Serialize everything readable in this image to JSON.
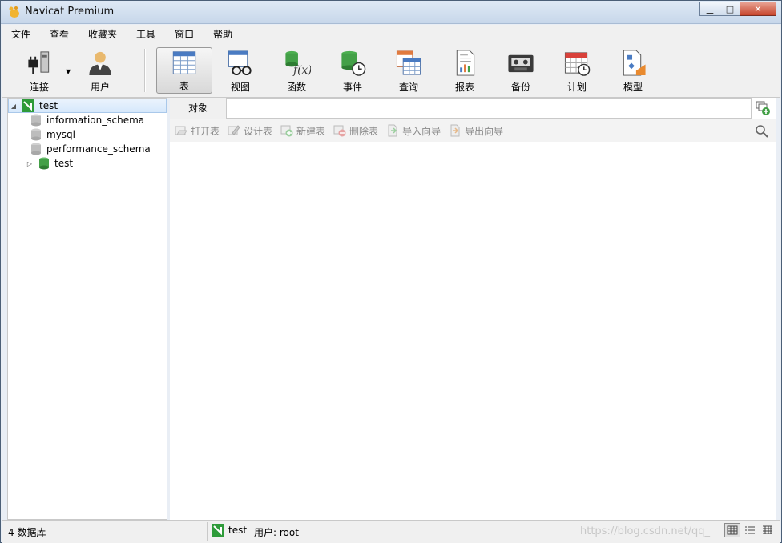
{
  "window": {
    "title": "Navicat Premium"
  },
  "menu": [
    "文件",
    "查看",
    "收藏夹",
    "工具",
    "窗口",
    "帮助"
  ],
  "toolbar": {
    "connect": "连接",
    "user": "用户",
    "items": [
      "表",
      "视图",
      "函数",
      "事件",
      "查询",
      "报表",
      "备份",
      "计划",
      "模型"
    ]
  },
  "tree": {
    "connection": "test",
    "databases": [
      "information_schema",
      "mysql",
      "performance_schema",
      "test"
    ]
  },
  "objects": {
    "tab_label": "对象",
    "actions": [
      "打开表",
      "设计表",
      "新建表",
      "删除表",
      "导入向导",
      "导出向导"
    ]
  },
  "status": {
    "db_count": "4 数据库",
    "connection": "test",
    "user": "用户: root",
    "watermark": "https://blog.csdn.net/qq_"
  }
}
